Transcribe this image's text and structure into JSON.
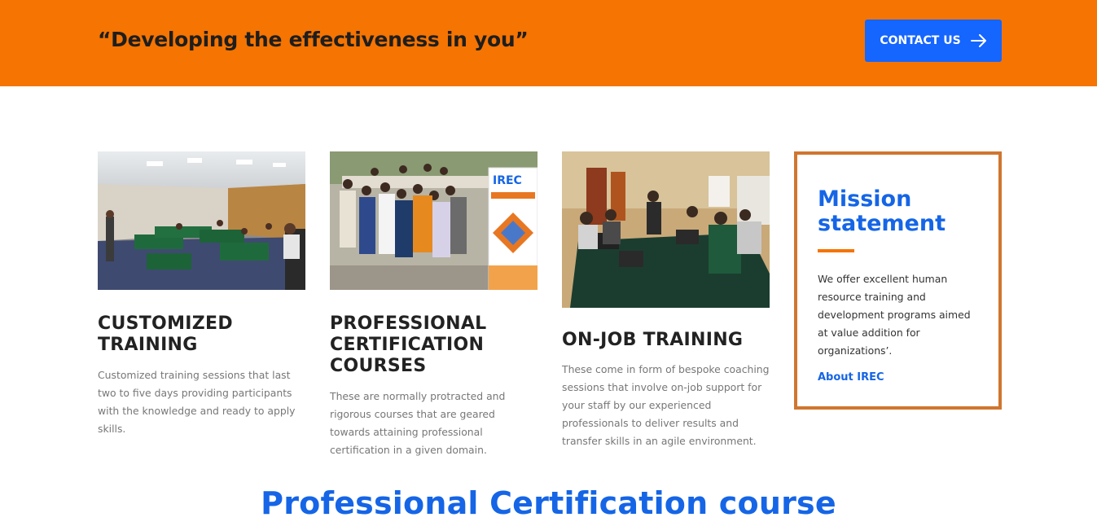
{
  "banner": {
    "tagline": "“Developing the effectiveness in you”",
    "contact_label": "CONTACT US",
    "contact_icon": "arrow-right-icon",
    "bg_color": "#f57402",
    "button_color": "#1565ff"
  },
  "cards": [
    {
      "title": "CUSTOMIZED TRAINING",
      "description": "Customized training sessions that last two to five days providing participants with the knowledge and ready to apply skills."
    },
    {
      "title": "PROFESSIONAL CERTIFICATION COURSES",
      "description": "These are normally protracted and rigorous courses that are geared towards attaining professional certification in a given domain.",
      "photo_banner_text": "IREC"
    },
    {
      "title": "ON-JOB TRAINING",
      "description": "These come in form of bespoke coaching sessions that involve on-job support for your staff by our experienced professionals to deliver results and transfer skills in an agile environment."
    }
  ],
  "mission": {
    "title": "Mission statement",
    "text": "We offer excellent human resource training and development programs aimed at value addition for organizations’.",
    "link_label": "About IREC",
    "border_color": "#d0762f",
    "accent_color": "#1565e6"
  },
  "section": {
    "title": "Professional Certification course"
  }
}
